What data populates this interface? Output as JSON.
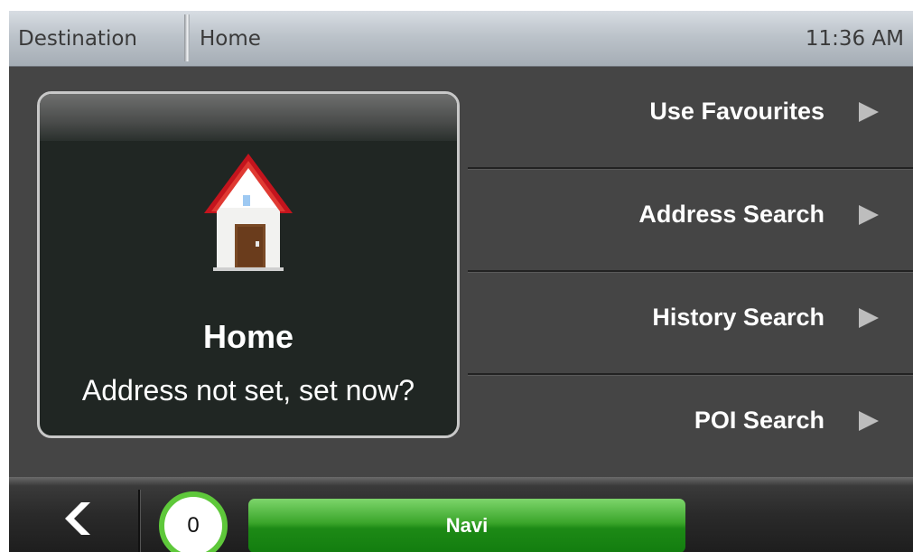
{
  "header": {
    "breadcrumb_destination": "Destination",
    "breadcrumb_home": "Home",
    "time": "11:36 AM"
  },
  "home_card": {
    "title": "Home",
    "subtitle": "Address not set, set now?",
    "icon": "house-icon"
  },
  "menu": {
    "items": [
      {
        "label": "Use Favourites",
        "icon": "arrow-right-icon"
      },
      {
        "label": "Address Search",
        "icon": "arrow-right-icon"
      },
      {
        "label": "History Search",
        "icon": "arrow-right-icon"
      },
      {
        "label": "POI Search",
        "icon": "arrow-right-icon"
      }
    ]
  },
  "footer": {
    "back_icon": "chevron-left-icon",
    "count": "0",
    "navi_label": "Navi"
  },
  "colors": {
    "background": "#454545",
    "navi_green": "#1d8a16",
    "badge_ring": "#5ec83a",
    "roof_red": "#d8202a",
    "door_brown": "#7a4a26"
  }
}
